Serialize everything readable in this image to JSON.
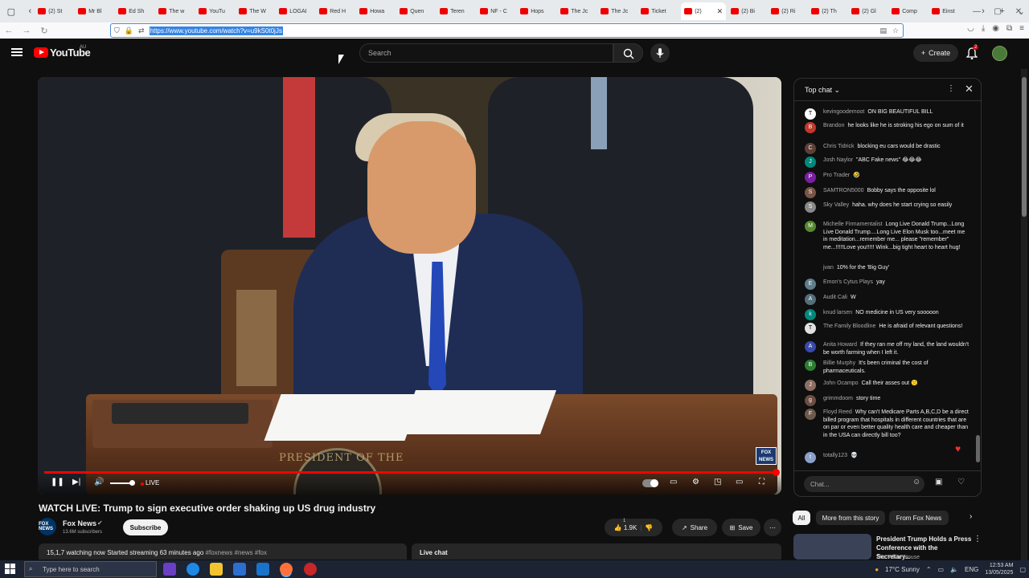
{
  "browser": {
    "tabs": [
      {
        "label": "(2) St"
      },
      {
        "label": "Mr Bl"
      },
      {
        "label": "Ed Sh"
      },
      {
        "label": "The w"
      },
      {
        "label": "YouTu"
      },
      {
        "label": "The W"
      },
      {
        "label": "LOGAI"
      },
      {
        "label": "Red H"
      },
      {
        "label": "Howa"
      },
      {
        "label": "Quen"
      },
      {
        "label": "Teren"
      },
      {
        "label": "NF - C"
      },
      {
        "label": "Hops"
      },
      {
        "label": "The Jc"
      },
      {
        "label": "The Jc"
      },
      {
        "label": "Ticket"
      },
      {
        "label": "(2)",
        "active": true
      },
      {
        "label": "(2) Bi"
      },
      {
        "label": "(2) Ri"
      },
      {
        "label": "(2) Th"
      },
      {
        "label": "(2) Gl"
      },
      {
        "label": "Comp"
      },
      {
        "label": "Einst"
      }
    ],
    "url": "https://www.youtube.com/watch?v=u9kS0t0jJs"
  },
  "youtube": {
    "logo_text": "YouTube",
    "region": "AU",
    "search_placeholder": "Search",
    "create_label": "Create",
    "notifications_count": "2"
  },
  "player": {
    "live_label": "LIVE",
    "seal_text": "PRESIDENT OF THE",
    "network_bug_line1": "FOX",
    "network_bug_line2": "NEWS"
  },
  "video": {
    "title": "WATCH LIVE: Trump to sign executive order shaking up US drug industry",
    "channel": "Fox News",
    "subscribers": "13.6M subscribers",
    "subscribe_label": "Subscribe",
    "like_count": "1.9K",
    "like_count_top": "1",
    "share_label": "Share",
    "save_label": "Save",
    "watching": "watching now",
    "watching_count": "15,1,7",
    "started": "Started streaming 63 minutes ago",
    "hashtags": "#foxnews #news #fox",
    "live_chat_label": "Live chat",
    "channel_avatar_text": "FOX NEWS"
  },
  "chat": {
    "header": "Top chat",
    "input_placeholder": "Chat...",
    "messages": [
      {
        "author": "kevingoodemoot",
        "text": "ON BIG BEAUTIFUL BILL",
        "avatar": "T",
        "color": "#ffffff"
      },
      {
        "author": "Brandon",
        "text": "he looks like he is stroking his ego on sum of it",
        "avatar": "B",
        "color": "#c0392b"
      },
      {
        "author": "Chris Tidrick",
        "text": "blocking eu cars would be drastic",
        "avatar": "C",
        "color": "#5d4037"
      },
      {
        "author": "Josh Naylor",
        "text": "\"ABC Fake news\" 😂😂😂",
        "avatar": "J",
        "color": "#00897b"
      },
      {
        "author": "Pro Trader",
        "text": "🤣",
        "avatar": "P",
        "color": "#7b1fa2"
      },
      {
        "author": "SAMTRON5000",
        "text": "Bobby says the opposite lol",
        "avatar": "S",
        "color": "#795548"
      },
      {
        "author": "Sky Valley",
        "text": "haha. why does he start crying so easily",
        "avatar": "S",
        "color": "#888"
      },
      {
        "author": "Michelle Firmamentalist",
        "text": "Long Live Donald Trump...Long Live Donald Trump....Long Live Elon Musk too...meet me in meditation...remember me... please \"remember\" me...!!!!!Love you!!!!! Wink...big tight heart to heart hug!",
        "avatar": "M",
        "color": "#558b2f"
      },
      {
        "author": "jvan",
        "text": "10% for the 'Big Guy'",
        "avatar": "",
        "color": "#0f0f0f"
      },
      {
        "author": "Emon's Cytus Plays",
        "text": "yay",
        "avatar": "E",
        "color": "#607d8b"
      },
      {
        "author": "Audit Cali",
        "text": "W",
        "avatar": "A",
        "color": "#546e7a"
      },
      {
        "author": "knud larsen",
        "text": "NO medicine in US very sooooon",
        "avatar": "k",
        "color": "#00897b"
      },
      {
        "author": "The Family Bloodline",
        "text": "He is afraid of relevant questions!",
        "avatar": "T",
        "color": "#e0e0e0"
      },
      {
        "author": "Anita Howard",
        "text": "If they ran me off my land, the land wouldn't be worth farming when I left it.",
        "avatar": "A",
        "color": "#3949ab"
      },
      {
        "author": "Billie Murphy",
        "text": "It's been criminal the cost of pharmaceuticals.",
        "avatar": "B",
        "color": "#2e7d32"
      },
      {
        "author": "John Ocampo",
        "text": "Call their asses out 🙁",
        "avatar": "J",
        "color": "#8d6e63"
      },
      {
        "author": "grimmdoom",
        "text": "story time",
        "avatar": "g",
        "color": "#6d4c41"
      },
      {
        "author": "Floyd Reed",
        "text": "Why can't Medicare Parts A,B,C,D be a direct billed program that hospitals in different countries that are on par or even better quality health care and cheaper than in the USA can directly bill too?",
        "avatar": "F",
        "color": "#6d5a4a"
      },
      {
        "author": "totally123",
        "text": "💀",
        "avatar": "t",
        "color": "#8aa0c8"
      }
    ]
  },
  "related": {
    "chips": [
      "All",
      "More from this story",
      "From Fox News"
    ],
    "title": "President Trump Holds a Press Conference with the Secretary...",
    "channel": "The White House"
  },
  "taskbar": {
    "search_placeholder": "Type here to search",
    "weather": "17°C  Sunny",
    "language": "ENG",
    "time": "12:53 AM",
    "date": "13/05/2025"
  }
}
